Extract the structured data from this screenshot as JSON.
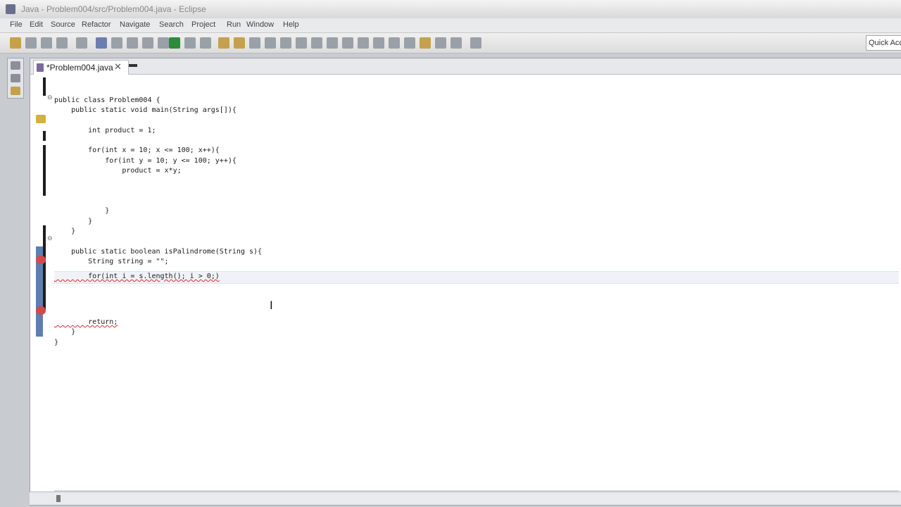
{
  "window": {
    "title": "Java - Problem004/src/Problem004.java - Eclipse"
  },
  "menu": {
    "items": [
      "File",
      "Edit",
      "Source",
      "Refactor",
      "Navigate",
      "Search",
      "Project",
      "Run",
      "Window",
      "Help"
    ]
  },
  "toolbar": {
    "quick_access_label": "Quick Access"
  },
  "editor": {
    "tab_label": "*Problem004.java",
    "lines": [
      "public class Problem004 {",
      "    public static void main(String args[]){",
      "        int product = 1;",
      "        for(int x = 10; x <= 100; x++){",
      "            for(int y = 10; y <= 100; y++){",
      "                product = x*y;",
      "            }",
      "        }",
      "    }",
      "    public static boolean isPalindrome(String s){",
      "        String string = \"\";",
      "        for(int i = s.length(); i > 0;)",
      "        return;",
      "    }",
      "}"
    ]
  },
  "icons": {
    "app": "eclipse-icon",
    "file": "java-file-icon",
    "close": "close-icon",
    "fold": "fold-icon",
    "error": "error-marker-icon",
    "warning": "warning-marker-icon",
    "cursor": "text-cursor-icon"
  },
  "colors": {
    "editor_bg": "#ffffff",
    "chrome_bg": "#c9ccd1",
    "error": "#d24a4a",
    "warning": "#d3b23a",
    "current_line": "#f0f2f8"
  }
}
